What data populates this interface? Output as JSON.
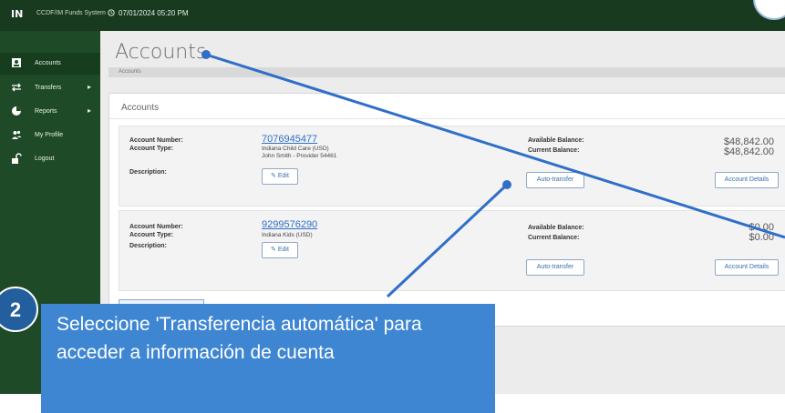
{
  "header": {
    "logo_text": "IN",
    "org_name": "CCDF/IM Funds System",
    "datetime": "07/01/2024 05:20 PM"
  },
  "sidebar": {
    "items": [
      {
        "label": "Accounts",
        "icon": "user-card-icon",
        "active": true,
        "has_submenu": false
      },
      {
        "label": "Transfers",
        "icon": "transfer-arrows-icon",
        "active": false,
        "has_submenu": true
      },
      {
        "label": "Reports",
        "icon": "pie-chart-icon",
        "active": false,
        "has_submenu": true
      },
      {
        "label": "My Profile",
        "icon": "users-icon",
        "active": false,
        "has_submenu": false
      },
      {
        "label": "Logout",
        "icon": "unlock-icon",
        "active": false,
        "has_submenu": false
      }
    ]
  },
  "page": {
    "title": "Accounts",
    "breadcrumb": "Accounts",
    "panel_title": "Accounts"
  },
  "labels": {
    "account_number": "Account Number:",
    "account_type": "Account Type:",
    "description": "Description:",
    "available_balance": "Available Balance:",
    "current_balance": "Current Balance:",
    "edit": "Edit",
    "auto_transfer": "Auto-transfer",
    "account_details": "Account Details"
  },
  "accounts": [
    {
      "number": "7076945477",
      "type": "Indiana Child Care (USD)",
      "holder": "John Smith - Provider 54461",
      "available_balance": "$48,842.00",
      "current_balance": "$48,842.00"
    },
    {
      "number": "9299576290",
      "type": "Indiana Kids (USD)",
      "holder": "",
      "available_balance": "$0.00",
      "current_balance": "$0.00"
    }
  ],
  "callout": {
    "step": "2",
    "text": "Seleccione 'Transferencia automática' para acceder a información de cuenta"
  },
  "colors": {
    "sidebar": "#1f4a27",
    "topbar": "#183a1f",
    "callout": "#3f86d2",
    "link": "#2f6fc7"
  }
}
